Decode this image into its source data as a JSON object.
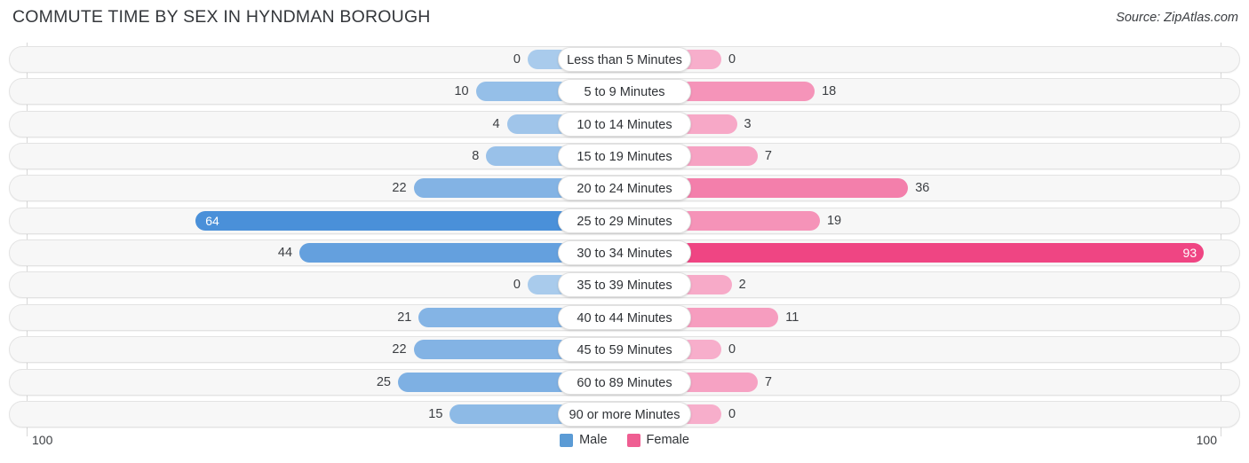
{
  "header": {
    "title": "COMMUTE TIME BY SEX IN HYNDMAN BOROUGH",
    "source": "Source: ZipAtlas.com"
  },
  "legend": {
    "male_label": "Male",
    "female_label": "Female",
    "male_color": "#5b9bd5",
    "female_color": "#ef5e92"
  },
  "axis": {
    "left_label": "100",
    "right_label": "100",
    "max": 100
  },
  "chart_data": {
    "type": "bar",
    "title": "COMMUTE TIME BY SEX IN HYNDMAN BOROUGH",
    "subtitle": "Source: ZipAtlas.com",
    "orientation": "horizontal-diverging",
    "xlabel": "",
    "ylabel": "",
    "xlim": [
      100,
      100
    ],
    "grid": false,
    "legend_position": "bottom-center",
    "categories": [
      "Less than 5 Minutes",
      "5 to 9 Minutes",
      "10 to 14 Minutes",
      "15 to 19 Minutes",
      "20 to 24 Minutes",
      "25 to 29 Minutes",
      "30 to 34 Minutes",
      "35 to 39 Minutes",
      "40 to 44 Minutes",
      "45 to 59 Minutes",
      "60 to 89 Minutes",
      "90 or more Minutes"
    ],
    "series": [
      {
        "name": "Male",
        "color": "#5b9bd5",
        "values": [
          0,
          10,
          4,
          8,
          22,
          64,
          44,
          0,
          21,
          22,
          25,
          15
        ]
      },
      {
        "name": "Female",
        "color": "#ef5e92",
        "values": [
          0,
          18,
          3,
          7,
          36,
          19,
          93,
          2,
          11,
          0,
          7,
          0
        ]
      }
    ]
  },
  "rows": [
    {
      "label": "Less than 5 Minutes",
      "male": 0,
      "male_text": "0",
      "female": 0,
      "female_text": "0"
    },
    {
      "label": "5 to 9 Minutes",
      "male": 10,
      "male_text": "10",
      "female": 18,
      "female_text": "18"
    },
    {
      "label": "10 to 14 Minutes",
      "male": 4,
      "male_text": "4",
      "female": 3,
      "female_text": "3"
    },
    {
      "label": "15 to 19 Minutes",
      "male": 8,
      "male_text": "8",
      "female": 7,
      "female_text": "7"
    },
    {
      "label": "20 to 24 Minutes",
      "male": 22,
      "male_text": "22",
      "female": 36,
      "female_text": "36"
    },
    {
      "label": "25 to 29 Minutes",
      "male": 64,
      "male_text": "64",
      "female": 19,
      "female_text": "19"
    },
    {
      "label": "30 to 34 Minutes",
      "male": 44,
      "male_text": "44",
      "female": 93,
      "female_text": "93"
    },
    {
      "label": "35 to 39 Minutes",
      "male": 0,
      "male_text": "0",
      "female": 2,
      "female_text": "2"
    },
    {
      "label": "40 to 44 Minutes",
      "male": 21,
      "male_text": "21",
      "female": 11,
      "female_text": "11"
    },
    {
      "label": "45 to 59 Minutes",
      "male": 22,
      "male_text": "22",
      "female": 0,
      "female_text": "0"
    },
    {
      "label": "60 to 89 Minutes",
      "male": 25,
      "male_text": "25",
      "female": 7,
      "female_text": "7"
    },
    {
      "label": "90 or more Minutes",
      "male": 15,
      "male_text": "15",
      "female": 0,
      "female_text": "0"
    }
  ]
}
